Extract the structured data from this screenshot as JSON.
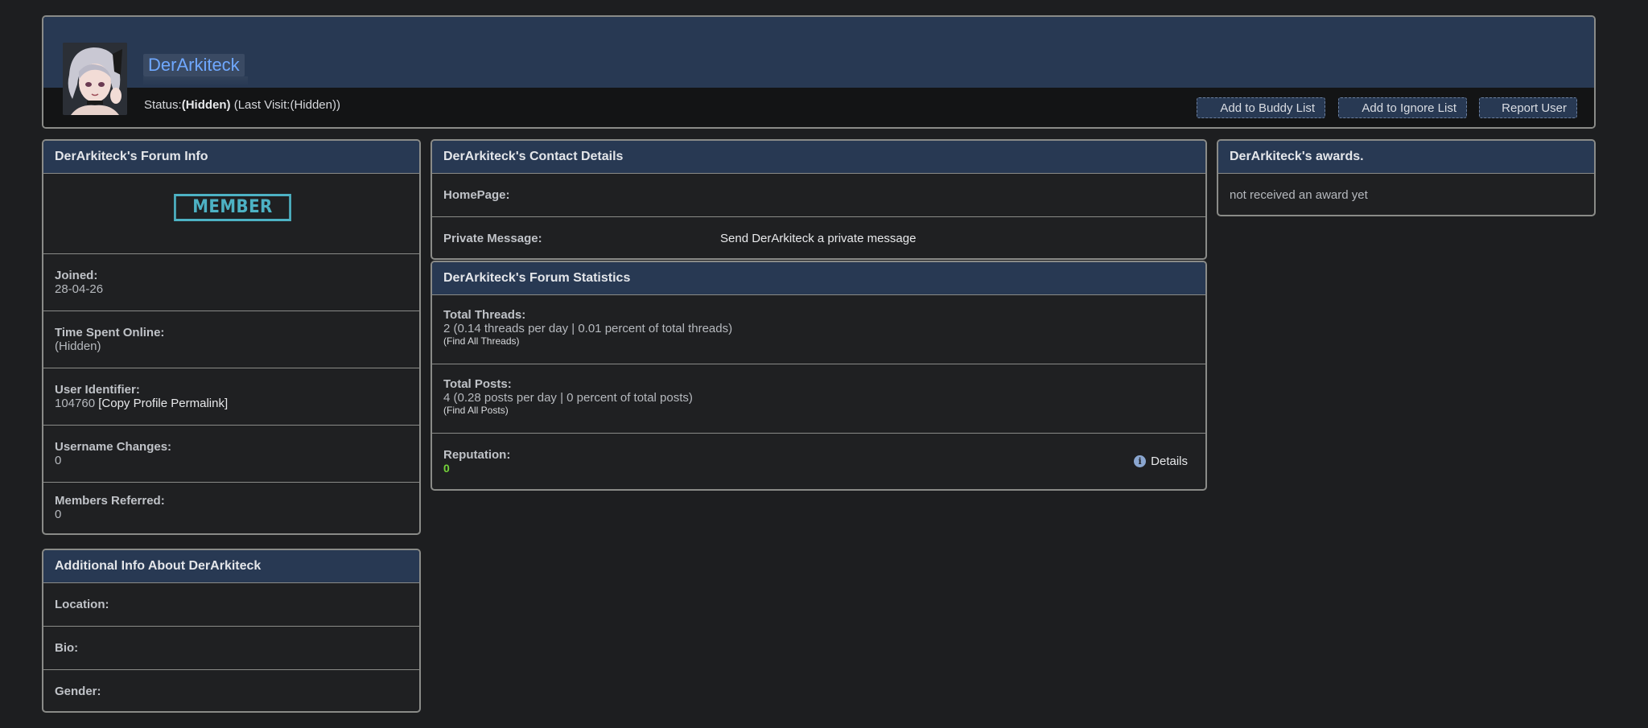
{
  "header": {
    "username": "DerArkiteck",
    "status_label": "Status:",
    "status_value": "(Hidden)",
    "last_visit": "(Last Visit:(Hidden))",
    "buttons": {
      "buddy": "Add to Buddy List",
      "ignore": "Add to Ignore List",
      "report": "Report User"
    }
  },
  "forum_info": {
    "title": "DerArkiteck's Forum Info",
    "badge": "MEMBER",
    "joined_label": "Joined:",
    "joined_value": "28-04-26",
    "time_online_label": "Time Spent Online:",
    "time_online_value": "(Hidden)",
    "user_id_label": "User Identifier:",
    "user_id_value": "104760",
    "permalink": "[Copy Profile Permalink]",
    "username_changes_label": "Username Changes:",
    "username_changes_value": "0",
    "members_referred_label": "Members Referred:",
    "members_referred_value": "0"
  },
  "additional_info": {
    "title": "Additional Info About DerArkiteck",
    "location_label": "Location:",
    "bio_label": "Bio:",
    "gender_label": "Gender:"
  },
  "contact": {
    "title": "DerArkiteck's Contact Details",
    "homepage_label": "HomePage:",
    "pm_label": "Private Message:",
    "pm_link": "Send DerArkiteck a private message"
  },
  "statistics": {
    "title": "DerArkiteck's Forum Statistics",
    "threads_label": "Total Threads:",
    "threads_value": "2 (0.14 threads per day | 0.01 percent of total threads)",
    "threads_link": "(Find All Threads)",
    "posts_label": "Total Posts:",
    "posts_value": "4 (0.28 posts per day | 0 percent of total posts)",
    "posts_link": "(Find All Posts)",
    "reputation_label": "Reputation:",
    "reputation_value": "0",
    "details_link": "Details",
    "info_icon": "i"
  },
  "awards": {
    "title": "DerArkiteck's awards.",
    "text": "not received an award yet"
  }
}
